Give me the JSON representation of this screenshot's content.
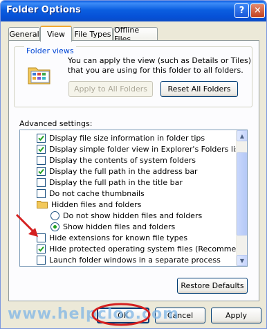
{
  "window": {
    "title": "Folder Options"
  },
  "titlebar": {
    "help_glyph": "?",
    "close_glyph": "✕"
  },
  "tabs": [
    {
      "label": "General"
    },
    {
      "label": "View"
    },
    {
      "label": "File Types"
    },
    {
      "label": "Offline Files"
    }
  ],
  "folder_views": {
    "legend": "Folder views",
    "description": "You can apply the view (such as Details or Tiles) that you are using for this folder to all folders.",
    "apply_button": "Apply to All Folders",
    "reset_button": "Reset All Folders"
  },
  "advanced": {
    "label": "Advanced settings:",
    "items": [
      {
        "type": "checkbox",
        "checked": true,
        "label": "Display file size information in folder tips"
      },
      {
        "type": "checkbox",
        "checked": true,
        "label": "Display simple folder view in Explorer's Folders list"
      },
      {
        "type": "checkbox",
        "checked": false,
        "label": "Display the contents of system folders"
      },
      {
        "type": "checkbox",
        "checked": true,
        "label": "Display the full path in the address bar"
      },
      {
        "type": "checkbox",
        "checked": false,
        "label": "Display the full path in the title bar"
      },
      {
        "type": "checkbox",
        "checked": false,
        "label": "Do not cache thumbnails"
      },
      {
        "type": "folder",
        "label": "Hidden files and folders"
      },
      {
        "type": "radio",
        "checked": false,
        "label": "Do not show hidden files and folders"
      },
      {
        "type": "radio",
        "checked": true,
        "label": "Show hidden files and folders"
      },
      {
        "type": "checkbox",
        "checked": false,
        "label": "Hide extensions for known file types"
      },
      {
        "type": "checkbox",
        "checked": true,
        "label": "Hide protected operating system files (Recommended)"
      },
      {
        "type": "checkbox",
        "checked": false,
        "label": "Launch folder windows in a separate process"
      }
    ]
  },
  "restore_button": "Restore Defaults",
  "footer": {
    "ok": "OK",
    "cancel": "Cancel",
    "apply": "Apply"
  },
  "watermark": "www.helpcloo.com",
  "colors": {
    "accent_red": "#d42020",
    "check_green": "#21a121",
    "title_blue": "#0a5ae0"
  }
}
